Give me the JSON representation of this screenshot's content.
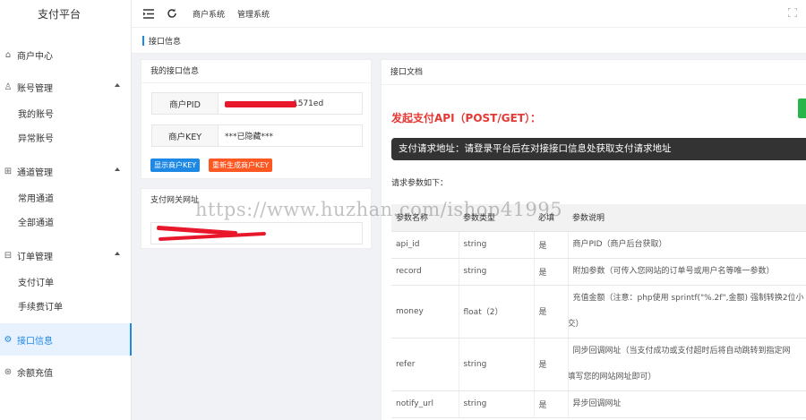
{
  "app": {
    "title": "支付平台"
  },
  "sidebar": {
    "items": [
      {
        "label": "商户中心",
        "icon": "home-icon"
      },
      {
        "label": "账号管理",
        "icon": "user-icon",
        "expanded": true,
        "children": [
          "我的账号",
          "异常账号"
        ]
      },
      {
        "label": "通道管理",
        "icon": "channel-icon",
        "expanded": true,
        "children": [
          "常用通道",
          "全部通道"
        ]
      },
      {
        "label": "订单管理",
        "icon": "order-icon",
        "expanded": true,
        "children": [
          "支付订单",
          "手续费订单"
        ]
      },
      {
        "label": "接口信息",
        "icon": "gear-icon",
        "active": true
      },
      {
        "label": "余额充值",
        "icon": "wallet-icon"
      }
    ]
  },
  "topbar": {
    "links": [
      "商户系统",
      "管理系统"
    ]
  },
  "breadcrumb": {
    "current": "接口信息"
  },
  "interface_card": {
    "title": "我的接口信息",
    "pid_label": "商户PID",
    "pid_value": "1571ed",
    "key_label": "商户KEY",
    "key_value": "***已隐藏***",
    "show_key_button": "显示商户KEY",
    "regen_key_button": "重新生成商户KEY"
  },
  "gateway_card": {
    "title": "支付网关网址"
  },
  "doc": {
    "card_title": "接口文档",
    "heading": "发起支付API（POST/GET）：",
    "notice": "支付请求地址：请登录平台后在对接接口信息处获取支付请求地址",
    "params_label": "请求参数如下：",
    "table": {
      "headers": [
        "参数名称",
        "参数类型",
        "必填",
        "参数说明"
      ],
      "rows": [
        {
          "name": "api_id",
          "type": "string",
          "required": "是",
          "desc": "商户PID（商户后台获取）"
        },
        {
          "name": "record",
          "type": "string",
          "required": "是",
          "desc": "附加参数（可传入您网站的订单号或用户名等唯一参数）"
        },
        {
          "name": "money",
          "type": "float（2）",
          "required": "是",
          "desc": "充值金额（注意：php使用 sprintf(\"%.2f\",金额) 强制转换2位小",
          "desc2": "交）"
        },
        {
          "name": "refer",
          "type": "string",
          "required": "是",
          "desc": "同步回调网址（当支付成功或支付超时后将自动跳转到指定网",
          "desc2": "填写您的网站网址即可）"
        },
        {
          "name": "notify_url",
          "type": "string",
          "required": "是",
          "desc": "异步回调网址"
        }
      ]
    }
  },
  "watermark": "https://www.huzhan.com/ishop41995",
  "colors": {
    "accent": "#1e88e5",
    "danger": "#e53935",
    "orange": "#ff5722",
    "green": "#2ab54b",
    "redaction": "#e8172b"
  }
}
